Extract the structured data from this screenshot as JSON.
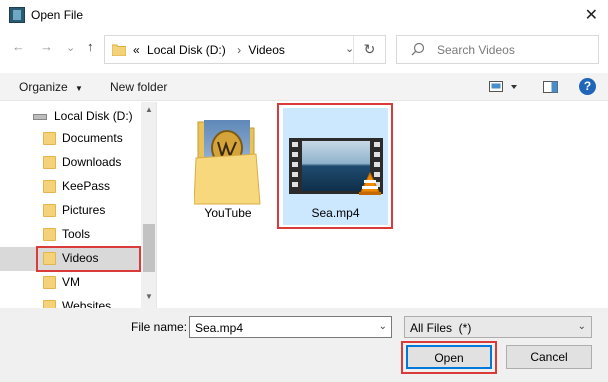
{
  "window": {
    "title": "Open File",
    "close_glyph": "✕"
  },
  "nav": {
    "back_glyph": "←",
    "forward_glyph": "→",
    "dropdown_glyph": "⌄",
    "up_glyph": "↑"
  },
  "address": {
    "overflow": "«",
    "crumbs": [
      "Local Disk (D:)",
      "Videos"
    ],
    "separator": "›",
    "dropdown_glyph": "⌄",
    "refresh_glyph": "↻"
  },
  "search": {
    "icon": "search-icon",
    "placeholder": "Search Videos"
  },
  "toolbar": {
    "organize_label": "Organize",
    "organize_caret": "▼",
    "new_folder_label": "New folder",
    "help_glyph": "?"
  },
  "sidebar": {
    "items": [
      {
        "label": "Local Disk (D:)",
        "icon": "disk-icon"
      },
      {
        "label": "Documents",
        "icon": "folder-icon"
      },
      {
        "label": "Downloads",
        "icon": "folder-icon"
      },
      {
        "label": "KeePass",
        "icon": "folder-icon"
      },
      {
        "label": "Pictures",
        "icon": "folder-icon"
      },
      {
        "label": "Tools",
        "icon": "folder-icon"
      },
      {
        "label": "Videos",
        "icon": "folder-icon",
        "selected": true
      },
      {
        "label": "VM",
        "icon": "folder-icon"
      },
      {
        "label": "Websites",
        "icon": "folder-icon"
      }
    ]
  },
  "files": [
    {
      "name": "YouTube",
      "type": "folder"
    },
    {
      "name": "Sea.mp4",
      "type": "video",
      "selected": true
    }
  ],
  "bottom": {
    "file_name_label": "File name:",
    "file_name_value": "Sea.mp4",
    "filter_value": "All Files  (*)",
    "dropdown_glyph": "⌄",
    "open_label": "Open",
    "cancel_label": "Cancel"
  },
  "colors": {
    "highlight_red": "#d93b3b",
    "selection_blue": "#cce8ff",
    "default_button_border": "#0078d7"
  }
}
